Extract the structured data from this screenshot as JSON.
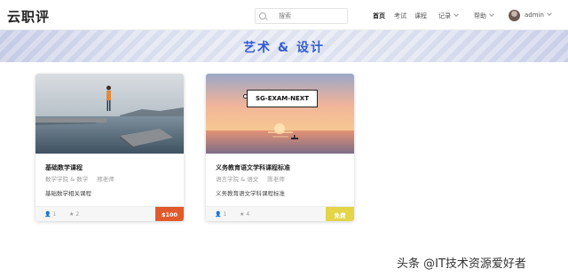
{
  "header": {
    "logo": "云职评",
    "search_placeholder": "搜索",
    "nav": {
      "home": "首页",
      "exam": "考试",
      "course": "课程",
      "record": "记录",
      "help": "帮助"
    },
    "user": "admin"
  },
  "banner": {
    "title": "艺术 & 设计"
  },
  "cards": [
    {
      "title": "基础数学课程",
      "category": "数学学院 & 数学",
      "teacher": "邢老师",
      "description": "基础数学相关课程",
      "students": "1",
      "rating": "2",
      "price": "$100",
      "price_color": "#e05a2b"
    },
    {
      "title": "义务教育语文学科课程标准",
      "category": "语言学院 & 语文",
      "teacher": "陈老师",
      "description": "义务教育语文学科课程标准",
      "students": "1",
      "rating": "4",
      "price": "免费",
      "price_color": "#e3d448",
      "badge": "SG-EXAM-NEXT"
    }
  ],
  "watermark": "头条 @IT技术资源爱好者"
}
